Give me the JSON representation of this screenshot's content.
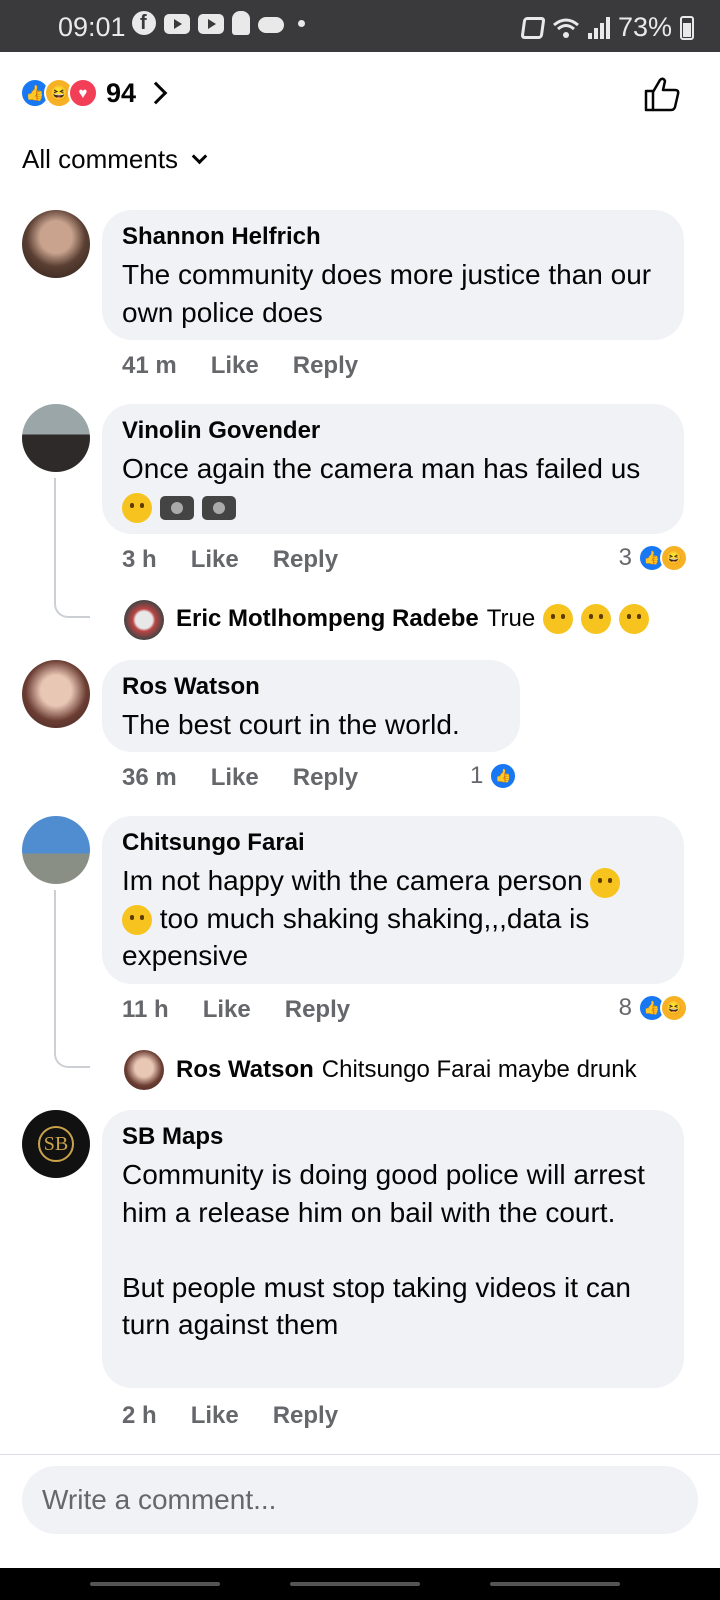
{
  "status_bar": {
    "time": "09:01",
    "battery": "73%",
    "icons": [
      "facebook-icon",
      "youtube-icon",
      "youtube-icon",
      "figure-icon",
      "weather-icon",
      "dot-icon",
      "mute-icon",
      "wifi-icon",
      "signal-icon",
      "battery-icon"
    ]
  },
  "header": {
    "reaction_total": "94",
    "reactions": [
      "like",
      "haha",
      "love"
    ],
    "filter_label": "All comments"
  },
  "comments": [
    {
      "author": "Shannon Helfrich",
      "text": "The community does more justice than our own police does",
      "time": "41 m",
      "like_label": "Like",
      "reply_label": "Reply"
    },
    {
      "author": "Vinolin Govender",
      "text": "Once again the camera man has failed us",
      "time": "3 h",
      "like_label": "Like",
      "reply_label": "Reply",
      "reaction_count": "3",
      "reply": {
        "author": "Eric Motlhompeng Radebe",
        "text": "True"
      }
    },
    {
      "author": "Ros Watson",
      "text": "The best court in the world.",
      "time": "36 m",
      "like_label": "Like",
      "reply_label": "Reply",
      "reaction_count": "1"
    },
    {
      "author": "Chitsungo Farai",
      "text": "Im not happy with the camera person",
      "text2": "too much shaking shaking,,,data is",
      "text3": "expensive",
      "time": "11 h",
      "like_label": "Like",
      "reply_label": "Reply",
      "reaction_count": "8",
      "reply": {
        "author": "Ros Watson",
        "text": "Chitsungo Farai maybe drunk"
      }
    },
    {
      "author": "SB Maps",
      "text": "Community is doing good police will arrest him a release him on bail with the court.\n\nBut people must stop taking videos it can turn against them",
      "time": "2 h",
      "like_label": "Like",
      "reply_label": "Reply",
      "avatar_text": "SB"
    }
  ],
  "composer": {
    "placeholder": "Write a comment..."
  },
  "colors": {
    "like_blue": "#1877f2",
    "haha_yellow": "#f7b125",
    "love_red": "#f33e58",
    "bubble_bg": "#f0f2f5",
    "meta_gray": "#65676b"
  }
}
